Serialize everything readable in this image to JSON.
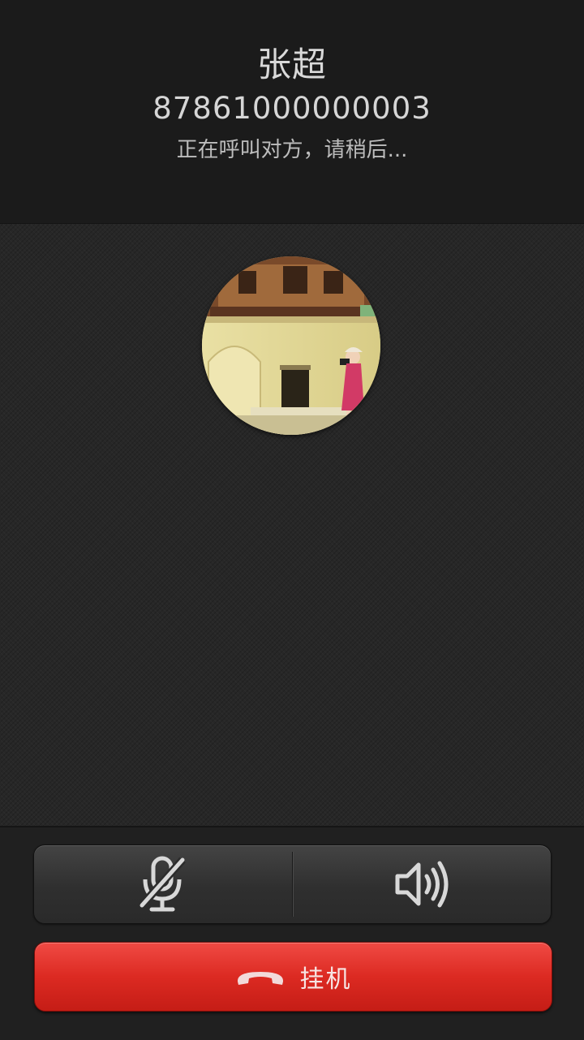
{
  "call": {
    "name": "张超",
    "number": "87861000000003",
    "status": "正在呼叫对方，请稍后..."
  },
  "controls": {
    "mute_icon": "microphone-muted-icon",
    "speaker_icon": "speaker-icon",
    "hangup_label": "挂机",
    "hangup_icon": "phone-hangup-icon"
  },
  "colors": {
    "header_bg": "#1b1b1b",
    "body_bg": "#272727",
    "hangup_red": "#dc2a22",
    "text": "#d9d9d9"
  }
}
